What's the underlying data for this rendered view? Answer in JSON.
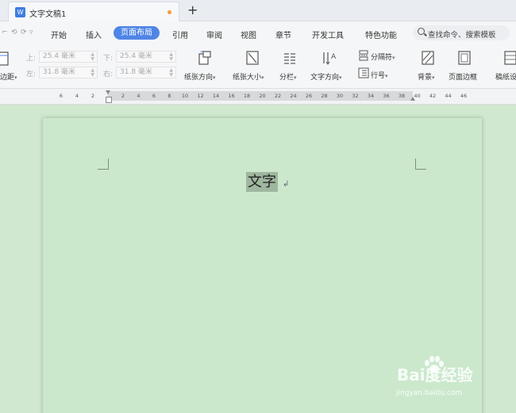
{
  "tabbar": {
    "doc_title": "文字文稿1",
    "doc_icon": "W",
    "new_tab": "+"
  },
  "menubar": {
    "quick_access": [
      "⌐",
      "⟲",
      "⟳",
      "▿"
    ],
    "items": [
      "开始",
      "插入",
      "页面布局",
      "引用",
      "审阅",
      "视图",
      "章节",
      "开发工具",
      "特色功能"
    ],
    "active_index": 2,
    "search_text": "查找命令、搜索模板"
  },
  "toolbar": {
    "margins_label": "边距",
    "top_label": "上:",
    "top_value": "25.4 毫米",
    "bottom_label": "下:",
    "bottom_value": "25.4 毫米",
    "left_label": "左:",
    "left_value": "31.8 毫米",
    "right_label": "右:",
    "right_value": "31.8 毫米",
    "orientation": "纸张方向",
    "size": "纸张大小",
    "columns": "分栏",
    "text_direction": "文字方向",
    "separator": "分隔符",
    "line_numbers": "行号",
    "background": "背景",
    "page_border": "页面边框",
    "manuscript": "稿纸设"
  },
  "ruler": {
    "left_ticks": [
      "6",
      "4",
      "2"
    ],
    "right_ticks": [
      "2",
      "4",
      "6",
      "8",
      "10",
      "12",
      "14",
      "16",
      "18",
      "20",
      "22",
      "24",
      "26",
      "28",
      "30",
      "32",
      "34",
      "36",
      "38",
      "40",
      "42",
      "44",
      "46"
    ]
  },
  "document": {
    "selected_text": "文字",
    "paragraph_mark": "↲"
  },
  "watermark": {
    "main": "Bai度经验",
    "sub": "jingyan.baidu.com"
  },
  "colors": {
    "accent": "#4f85e6",
    "canvas_bg": "#cfe8cf",
    "selection": "#9fb79f",
    "unsaved_dot": "#f59a3c"
  }
}
